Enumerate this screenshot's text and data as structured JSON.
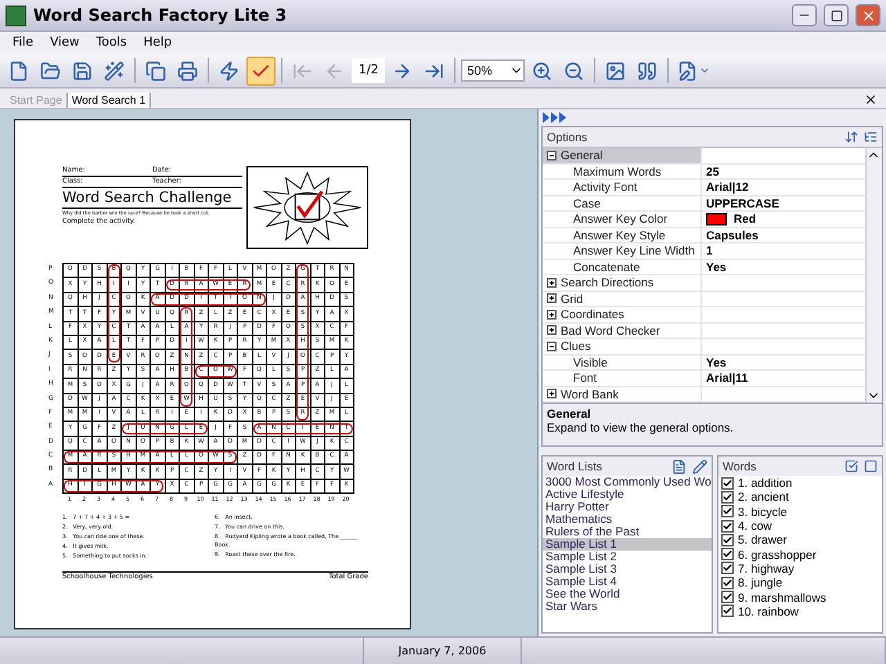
{
  "window": {
    "title": "Word Search Factory Lite 3"
  },
  "menu": [
    "File",
    "View",
    "Tools",
    "Help"
  ],
  "toolbar": [
    {
      "kind": "button",
      "disabled": false,
      "selected": false
    },
    {
      "kind": "button",
      "disabled": false,
      "selected": false
    },
    {
      "kind": "button",
      "disabled": false,
      "selected": false
    },
    {
      "kind": "button",
      "disabled": false,
      "selected": false
    },
    {
      "kind": "separator"
    },
    {
      "kind": "button",
      "disabled": false,
      "selected": false
    },
    {
      "kind": "button",
      "disabled": false,
      "selected": false
    },
    {
      "kind": "separator"
    },
    {
      "kind": "button",
      "disabled": false,
      "selected": false
    },
    {
      "kind": "button",
      "disabled": false,
      "selected": true
    },
    {
      "kind": "separator"
    },
    {
      "kind": "button",
      "disabled": true,
      "selected": false
    },
    {
      "kind": "button",
      "disabled": true,
      "selected": false
    },
    {
      "kind": "page",
      "label": "1/2"
    },
    {
      "kind": "button",
      "disabled": false,
      "selected": false
    },
    {
      "kind": "button",
      "disabled": false,
      "selected": false
    },
    {
      "kind": "separator"
    },
    {
      "kind": "zoom",
      "label": "50%"
    },
    {
      "kind": "button",
      "disabled": false,
      "selected": false
    },
    {
      "kind": "button",
      "disabled": false,
      "selected": false
    },
    {
      "kind": "separator"
    },
    {
      "kind": "button",
      "disabled": false,
      "selected": false
    },
    {
      "kind": "button",
      "disabled": false,
      "selected": false
    },
    {
      "kind": "separator"
    },
    {
      "kind": "menu-button",
      "disabled": false,
      "selected": false
    }
  ],
  "tabs": [
    {
      "label": "Start Page",
      "selected": false
    },
    {
      "label": "Word Search 1",
      "selected": true
    }
  ],
  "document": {
    "fields": [
      [
        "Name:",
        "Date:"
      ],
      [
        "Class:",
        "Teacher:"
      ]
    ],
    "title": "Word Search Challenge",
    "subtitle": "Why did the barber win the race? Because he took a short cut.",
    "instructions": "Complete the activity.",
    "row_labels": [
      "P",
      "O",
      "N",
      "M",
      "L",
      "K",
      "J",
      "I",
      "H",
      "G",
      "F",
      "E",
      "D",
      "C",
      "B",
      "A"
    ],
    "column_labels": [
      "1",
      "2",
      "3",
      "4",
      "5",
      "6",
      "7",
      "8",
      "9",
      "10",
      "11",
      "12",
      "13",
      "14",
      "15",
      "16",
      "17",
      "18",
      "19",
      "20"
    ],
    "grid": [
      [
        {
          "letter": "Q"
        },
        {
          "letter": "D"
        },
        {
          "letter": "S"
        },
        {
          "letter": "B",
          "down": true
        },
        {
          "letter": "Q"
        },
        {
          "letter": "Y"
        },
        {
          "letter": "G"
        },
        {
          "letter": "I"
        },
        {
          "letter": "B"
        },
        {
          "letter": "F"
        },
        {
          "letter": "F"
        },
        {
          "letter": "L"
        },
        {
          "letter": "V"
        },
        {
          "letter": "M"
        },
        {
          "letter": "O"
        },
        {
          "letter": "Z"
        },
        {
          "letter": "G",
          "down": true
        },
        {
          "letter": "T"
        },
        {
          "letter": "R"
        },
        {
          "letter": "N"
        }
      ],
      [
        {
          "letter": "X"
        },
        {
          "letter": "Y"
        },
        {
          "letter": "H"
        },
        {
          "letter": "I",
          "down": true
        },
        {
          "letter": "I"
        },
        {
          "letter": "Y"
        },
        {
          "letter": "T"
        },
        {
          "letter": "D",
          "across": true
        },
        {
          "letter": "R",
          "across": true
        },
        {
          "letter": "A",
          "across": true
        },
        {
          "letter": "W",
          "across": true
        },
        {
          "letter": "E",
          "across": true
        },
        {
          "letter": "R",
          "across": true
        },
        {
          "letter": "M"
        },
        {
          "letter": "E"
        },
        {
          "letter": "C"
        },
        {
          "letter": "R",
          "down": true
        },
        {
          "letter": "K"
        },
        {
          "letter": "O"
        },
        {
          "letter": "E"
        }
      ],
      [
        {
          "letter": "Q"
        },
        {
          "letter": "H"
        },
        {
          "letter": "J"
        },
        {
          "letter": "C",
          "down": true
        },
        {
          "letter": "O"
        },
        {
          "letter": "K"
        },
        {
          "letter": "A",
          "across": true
        },
        {
          "letter": "D",
          "across": true
        },
        {
          "letter": "D",
          "across": true
        },
        {
          "letter": "I",
          "across": true
        },
        {
          "letter": "T",
          "across": true
        },
        {
          "letter": "I",
          "across": true
        },
        {
          "letter": "O",
          "across": true
        },
        {
          "letter": "N",
          "across": true
        },
        {
          "letter": "J"
        },
        {
          "letter": "D"
        },
        {
          "letter": "A",
          "down": true
        },
        {
          "letter": "H"
        },
        {
          "letter": "D"
        },
        {
          "letter": "S"
        }
      ],
      [
        {
          "letter": "T"
        },
        {
          "letter": "T"
        },
        {
          "letter": "F"
        },
        {
          "letter": "Y",
          "down": true
        },
        {
          "letter": "M"
        },
        {
          "letter": "V"
        },
        {
          "letter": "U"
        },
        {
          "letter": "Q"
        },
        {
          "letter": "R",
          "down": true
        },
        {
          "letter": "Z"
        },
        {
          "letter": "L"
        },
        {
          "letter": "Z"
        },
        {
          "letter": "E"
        },
        {
          "letter": "C"
        },
        {
          "letter": "X"
        },
        {
          "letter": "E"
        },
        {
          "letter": "S",
          "down": true
        },
        {
          "letter": "Y"
        },
        {
          "letter": "A"
        },
        {
          "letter": "X"
        }
      ],
      [
        {
          "letter": "F"
        },
        {
          "letter": "X"
        },
        {
          "letter": "Y"
        },
        {
          "letter": "C",
          "down": true
        },
        {
          "letter": "T"
        },
        {
          "letter": "A"
        },
        {
          "letter": "A"
        },
        {
          "letter": "L"
        },
        {
          "letter": "A",
          "down": true
        },
        {
          "letter": "Y"
        },
        {
          "letter": "R"
        },
        {
          "letter": "J"
        },
        {
          "letter": "P"
        },
        {
          "letter": "D"
        },
        {
          "letter": "F"
        },
        {
          "letter": "O"
        },
        {
          "letter": "S",
          "down": true
        },
        {
          "letter": "X"
        },
        {
          "letter": "C"
        },
        {
          "letter": "F"
        }
      ],
      [
        {
          "letter": "L"
        },
        {
          "letter": "X"
        },
        {
          "letter": "A"
        },
        {
          "letter": "L",
          "down": true
        },
        {
          "letter": "T"
        },
        {
          "letter": "F"
        },
        {
          "letter": "P"
        },
        {
          "letter": "D"
        },
        {
          "letter": "I",
          "down": true
        },
        {
          "letter": "W"
        },
        {
          "letter": "K"
        },
        {
          "letter": "P"
        },
        {
          "letter": "R"
        },
        {
          "letter": "Y"
        },
        {
          "letter": "M"
        },
        {
          "letter": "X"
        },
        {
          "letter": "H",
          "down": true
        },
        {
          "letter": "S"
        },
        {
          "letter": "M"
        },
        {
          "letter": "K"
        }
      ],
      [
        {
          "letter": "S"
        },
        {
          "letter": "O"
        },
        {
          "letter": "D"
        },
        {
          "letter": "E",
          "down": true
        },
        {
          "letter": "V"
        },
        {
          "letter": "R"
        },
        {
          "letter": "O"
        },
        {
          "letter": "Z"
        },
        {
          "letter": "N",
          "down": true
        },
        {
          "letter": "Z"
        },
        {
          "letter": "C"
        },
        {
          "letter": "P"
        },
        {
          "letter": "B"
        },
        {
          "letter": "L"
        },
        {
          "letter": "V"
        },
        {
          "letter": "J"
        },
        {
          "letter": "O",
          "down": true
        },
        {
          "letter": "C"
        },
        {
          "letter": "P"
        },
        {
          "letter": "Y"
        }
      ],
      [
        {
          "letter": "R"
        },
        {
          "letter": "N"
        },
        {
          "letter": "R"
        },
        {
          "letter": "Z"
        },
        {
          "letter": "Y"
        },
        {
          "letter": "S"
        },
        {
          "letter": "A"
        },
        {
          "letter": "H"
        },
        {
          "letter": "B",
          "down": true
        },
        {
          "letter": "C",
          "across": true
        },
        {
          "letter": "O",
          "across": true
        },
        {
          "letter": "W",
          "across": true
        },
        {
          "letter": "F"
        },
        {
          "letter": "Q"
        },
        {
          "letter": "L"
        },
        {
          "letter": "S"
        },
        {
          "letter": "P",
          "down": true
        },
        {
          "letter": "Z"
        },
        {
          "letter": "L"
        },
        {
          "letter": "A"
        }
      ],
      [
        {
          "letter": "M"
        },
        {
          "letter": "S"
        },
        {
          "letter": "O"
        },
        {
          "letter": "X"
        },
        {
          "letter": "G"
        },
        {
          "letter": "J"
        },
        {
          "letter": "A"
        },
        {
          "letter": "R"
        },
        {
          "letter": "O",
          "down": true
        },
        {
          "letter": "Q"
        },
        {
          "letter": "D"
        },
        {
          "letter": "W"
        },
        {
          "letter": "T"
        },
        {
          "letter": "V"
        },
        {
          "letter": "S"
        },
        {
          "letter": "A"
        },
        {
          "letter": "P",
          "down": true
        },
        {
          "letter": "A"
        },
        {
          "letter": "J"
        },
        {
          "letter": "L"
        }
      ],
      [
        {
          "letter": "D"
        },
        {
          "letter": "W"
        },
        {
          "letter": "J"
        },
        {
          "letter": "A"
        },
        {
          "letter": "C"
        },
        {
          "letter": "K"
        },
        {
          "letter": "X"
        },
        {
          "letter": "E"
        },
        {
          "letter": "W",
          "down": true
        },
        {
          "letter": "H"
        },
        {
          "letter": "U"
        },
        {
          "letter": "S"
        },
        {
          "letter": "Y"
        },
        {
          "letter": "Q"
        },
        {
          "letter": "C"
        },
        {
          "letter": "Z"
        },
        {
          "letter": "E",
          "down": true
        },
        {
          "letter": "V"
        },
        {
          "letter": "J"
        },
        {
          "letter": "E"
        }
      ],
      [
        {
          "letter": "M"
        },
        {
          "letter": "M"
        },
        {
          "letter": "I"
        },
        {
          "letter": "V"
        },
        {
          "letter": "A"
        },
        {
          "letter": "L"
        },
        {
          "letter": "R"
        },
        {
          "letter": "I"
        },
        {
          "letter": "E"
        },
        {
          "letter": "I"
        },
        {
          "letter": "K"
        },
        {
          "letter": "D"
        },
        {
          "letter": "X"
        },
        {
          "letter": "B"
        },
        {
          "letter": "P"
        },
        {
          "letter": "S"
        },
        {
          "letter": "R",
          "down": true
        },
        {
          "letter": "Z"
        },
        {
          "letter": "M"
        },
        {
          "letter": "L"
        }
      ],
      [
        {
          "letter": "Y"
        },
        {
          "letter": "G"
        },
        {
          "letter": "F"
        },
        {
          "letter": "Z"
        },
        {
          "letter": "J",
          "across": true
        },
        {
          "letter": "U",
          "across": true
        },
        {
          "letter": "N",
          "across": true
        },
        {
          "letter": "G",
          "across": true
        },
        {
          "letter": "L",
          "across": true
        },
        {
          "letter": "E",
          "across": true
        },
        {
          "letter": "J"
        },
        {
          "letter": "F"
        },
        {
          "letter": "S"
        },
        {
          "letter": "A",
          "across": true
        },
        {
          "letter": "N",
          "across": true
        },
        {
          "letter": "C",
          "across": true
        },
        {
          "letter": "I",
          "across": true
        },
        {
          "letter": "E",
          "across": true
        },
        {
          "letter": "N",
          "across": true
        },
        {
          "letter": "T",
          "across": true
        }
      ],
      [
        {
          "letter": "Q"
        },
        {
          "letter": "C"
        },
        {
          "letter": "A"
        },
        {
          "letter": "O"
        },
        {
          "letter": "N"
        },
        {
          "letter": "O"
        },
        {
          "letter": "P"
        },
        {
          "letter": "B"
        },
        {
          "letter": "K"
        },
        {
          "letter": "W"
        },
        {
          "letter": "A"
        },
        {
          "letter": "D"
        },
        {
          "letter": "M"
        },
        {
          "letter": "D"
        },
        {
          "letter": "C"
        },
        {
          "letter": "I"
        },
        {
          "letter": "W"
        },
        {
          "letter": "J"
        },
        {
          "letter": "K"
        },
        {
          "letter": "C"
        }
      ],
      [
        {
          "letter": "M",
          "across": true
        },
        {
          "letter": "A",
          "across": true
        },
        {
          "letter": "R",
          "across": true
        },
        {
          "letter": "S",
          "across": true
        },
        {
          "letter": "H",
          "across": true
        },
        {
          "letter": "M",
          "across": true
        },
        {
          "letter": "A",
          "across": true
        },
        {
          "letter": "L",
          "across": true
        },
        {
          "letter": "L",
          "across": true
        },
        {
          "letter": "O",
          "across": true
        },
        {
          "letter": "W",
          "across": true
        },
        {
          "letter": "S",
          "across": true
        },
        {
          "letter": "Z"
        },
        {
          "letter": "D"
        },
        {
          "letter": "F"
        },
        {
          "letter": "N"
        },
        {
          "letter": "K"
        },
        {
          "letter": "B"
        },
        {
          "letter": "C"
        },
        {
          "letter": "A"
        }
      ],
      [
        {
          "letter": "R"
        },
        {
          "letter": "D"
        },
        {
          "letter": "L"
        },
        {
          "letter": "M"
        },
        {
          "letter": "Y"
        },
        {
          "letter": "K"
        },
        {
          "letter": "K"
        },
        {
          "letter": "P"
        },
        {
          "letter": "C"
        },
        {
          "letter": "Z"
        },
        {
          "letter": "Y"
        },
        {
          "letter": "I"
        },
        {
          "letter": "V"
        },
        {
          "letter": "F"
        },
        {
          "letter": "K"
        },
        {
          "letter": "Y"
        },
        {
          "letter": "H"
        },
        {
          "letter": "C"
        },
        {
          "letter": "Y"
        },
        {
          "letter": "W"
        }
      ],
      [
        {
          "letter": "H",
          "across": true
        },
        {
          "letter": "I",
          "across": true
        },
        {
          "letter": "G",
          "across": true
        },
        {
          "letter": "H",
          "across": true
        },
        {
          "letter": "W",
          "across": true
        },
        {
          "letter": "A",
          "across": true
        },
        {
          "letter": "Y",
          "across": true
        },
        {
          "letter": "X"
        },
        {
          "letter": "C"
        },
        {
          "letter": "P"
        },
        {
          "letter": "G"
        },
        {
          "letter": "G"
        },
        {
          "letter": "A"
        },
        {
          "letter": "G"
        },
        {
          "letter": "G"
        },
        {
          "letter": "K"
        },
        {
          "letter": "E"
        },
        {
          "letter": "F"
        },
        {
          "letter": "F"
        },
        {
          "letter": "K"
        }
      ]
    ],
    "clues": [
      [
        "1.",
        "7 + 7 + 4 + 3 + 5 ="
      ],
      [
        "2.",
        "Very, very old."
      ],
      [
        "3.",
        "You can ride one of these."
      ],
      [
        "4.",
        "It gives milk."
      ],
      [
        "5.",
        "Something to put socks in."
      ],
      [
        "6.",
        "An insect."
      ],
      [
        "7.",
        "You can drive on this."
      ],
      [
        "8.",
        "Rudyard Kipling wrote a book called, The ______ Book."
      ],
      [
        "9.",
        "Roast these over the fire."
      ]
    ],
    "footer": [
      "Schoolhouse Technologies",
      "Total Grade"
    ]
  },
  "options": {
    "title": "Options",
    "categories": [
      {
        "name": "General",
        "expanded": true,
        "selected": true,
        "properties": [
          {
            "name": "Maximum Words",
            "value": "25"
          },
          {
            "name": "Activity Font",
            "value": "Arial|12"
          },
          {
            "name": "Case",
            "value": "UPPERCASE"
          },
          {
            "name": "Answer Key Color",
            "value": "Red",
            "color": "#ff0000"
          },
          {
            "name": "Answer Key Style",
            "value": "Capsules"
          },
          {
            "name": "Answer Key Line Width",
            "value": "1"
          },
          {
            "name": "Concatenate",
            "value": "Yes"
          }
        ]
      },
      {
        "name": "Search Directions",
        "expanded": false,
        "selected": false
      },
      {
        "name": "Grid",
        "expanded": false,
        "selected": false
      },
      {
        "name": "Coordinates",
        "expanded": false,
        "selected": false
      },
      {
        "name": "Bad Word Checker",
        "expanded": false,
        "selected": false
      },
      {
        "name": "Clues",
        "expanded": true,
        "selected": false,
        "properties": [
          {
            "name": "Visible",
            "value": "Yes"
          },
          {
            "name": "Font",
            "value": "Arial|11"
          }
        ]
      },
      {
        "name": "Word Bank",
        "expanded": false,
        "selected": false
      }
    ],
    "description": {
      "title": "General",
      "text": "Expand to view the general options."
    }
  },
  "word_lists": {
    "title": "Word Lists",
    "items": [
      {
        "label": "3000 Most Commonly Used Wo",
        "selected": false
      },
      {
        "label": "Active Lifestyle",
        "selected": false
      },
      {
        "label": "Harry Potter",
        "selected": false
      },
      {
        "label": "Mathematics",
        "selected": false
      },
      {
        "label": "Rulers of the Past",
        "selected": false
      },
      {
        "label": "Sample List 1",
        "selected": true
      },
      {
        "label": "Sample List 2",
        "selected": false
      },
      {
        "label": "Sample List 3",
        "selected": false
      },
      {
        "label": "Sample List 4",
        "selected": false
      },
      {
        "label": "See the World",
        "selected": false
      },
      {
        "label": "Star Wars",
        "selected": false
      }
    ]
  },
  "words": {
    "title": "Words",
    "items": [
      {
        "label": "1. addition",
        "checked": true
      },
      {
        "label": "2. ancient",
        "checked": true
      },
      {
        "label": "3. bicycle",
        "checked": true
      },
      {
        "label": "4. cow",
        "checked": true
      },
      {
        "label": "5. drawer",
        "checked": true
      },
      {
        "label": "6. grasshopper",
        "checked": true
      },
      {
        "label": "7. highway",
        "checked": true
      },
      {
        "label": "8. jungle",
        "checked": true
      },
      {
        "label": "9. marshmallows",
        "checked": true
      },
      {
        "label": "10. rainbow",
        "checked": true
      }
    ]
  },
  "status_bar": {
    "date": "January 7, 2006"
  }
}
